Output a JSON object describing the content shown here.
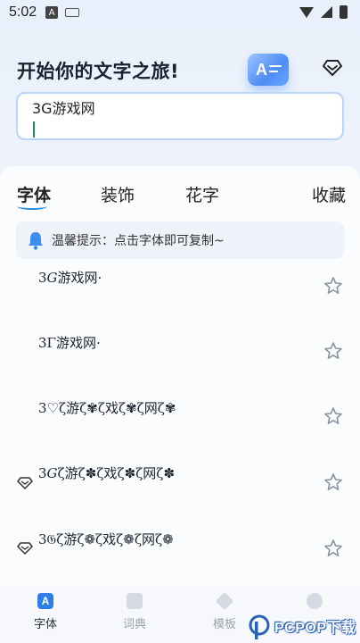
{
  "status_bar": {
    "time": "5:02",
    "app_badge": "A"
  },
  "header": {
    "title": "开始你的文字之旅!",
    "logo_text": "A"
  },
  "input": {
    "value": "3G游戏网"
  },
  "tabs": [
    {
      "label": "字体",
      "active": true
    },
    {
      "label": "装饰",
      "active": false
    },
    {
      "label": "花字",
      "active": false
    },
    {
      "label": "收藏",
      "active": false
    }
  ],
  "notice": {
    "text": "温馨提示：点击字体即可复制~"
  },
  "font_list": [
    {
      "text": "3𝐺游戏网·",
      "vip": false
    },
    {
      "text": "3Γ游戏网·",
      "vip": false
    },
    {
      "text": "3♡ζ游ζ✾ζ戏ζ✾ζ网ζ✾",
      "vip": false
    },
    {
      "text": "3𝐺ζ游ζ✽ζ戏ζ✽ζ网ζ✽",
      "vip": true
    },
    {
      "text": "3𝔊ζ游ζ❁ζ戏ζ❁ζ网ζ❁",
      "vip": true
    }
  ],
  "bottom_nav": [
    {
      "label": "字体",
      "icon": "font-a-icon",
      "active": true
    },
    {
      "label": "词典",
      "icon": "dictionary-icon",
      "active": false
    },
    {
      "label": "模板",
      "icon": "template-cube-icon",
      "active": false
    },
    {
      "label": "",
      "icon": "profile-icon",
      "active": false
    }
  ],
  "watermark": {
    "brand": "PCPOP下载",
    "logo": "P"
  },
  "colors": {
    "accent": "#2a8fe0",
    "input_border": "#b9d5f7",
    "logo_blue": "#4d8cf5"
  }
}
